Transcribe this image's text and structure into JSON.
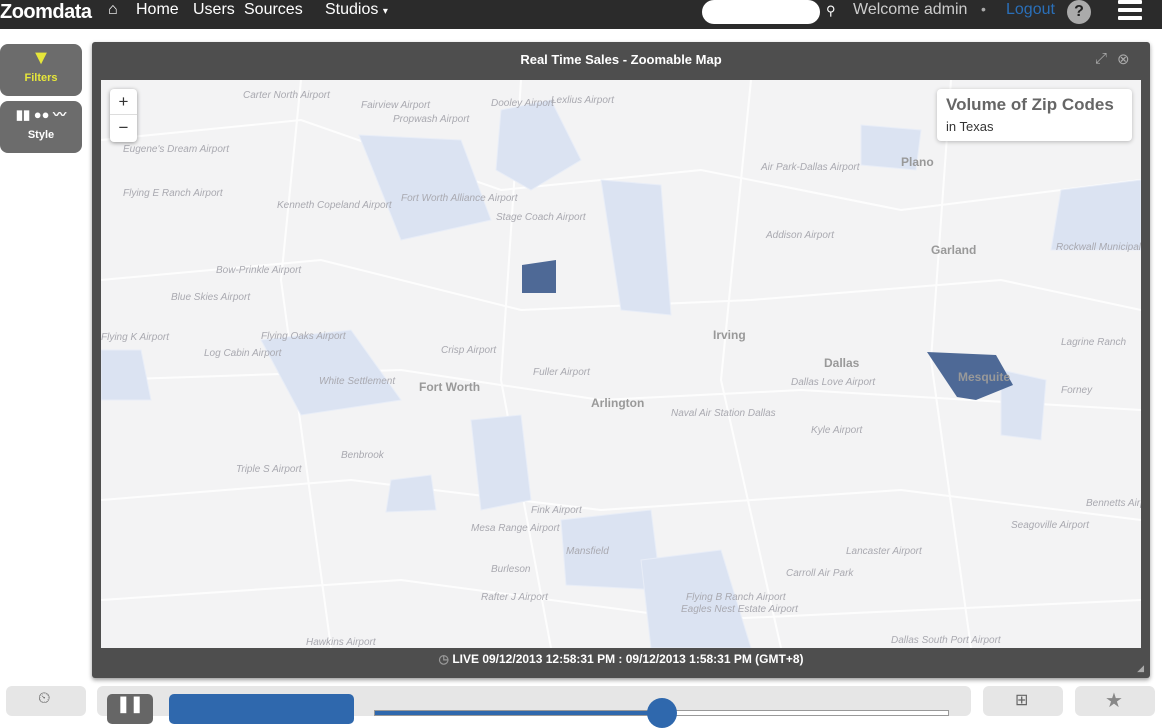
{
  "nav": {
    "brand": "Zoomdata",
    "home_icon": "home-icon",
    "links": [
      "Home",
      "Users",
      "Sources",
      "Studios"
    ],
    "search_placeholder": "",
    "welcome": "Welcome admin",
    "separator": "•",
    "logout": "Logout",
    "help": "?"
  },
  "sidebar": {
    "filters": "Filters",
    "style": "Style"
  },
  "panel": {
    "title": "Real Time Sales - Zoomable Map",
    "footer_live": "LIVE",
    "footer_range": "09/12/2013 12:58:31 PM : 09/12/2013 1:58:31 PM (GMT+8)"
  },
  "map": {
    "zoom_in": "+",
    "zoom_out": "−",
    "legend": {
      "title": "Volume of Zip Codes",
      "subtitle": "in Texas"
    },
    "cities": [
      "Plano",
      "Garland",
      "Irving",
      "Fort Worth",
      "Arlington",
      "Dallas",
      "Mesquite"
    ],
    "labels": [
      "Carter North Airport",
      "Fairview Airport",
      "Dooley Airport",
      "Lexlius Airport",
      "Propwash Airport",
      "Eugene's Dream Airport",
      "Flying E Ranch Airport",
      "Kenneth Copeland Airport",
      "Fort Worth Alliance Airport",
      "Stage Coach Airport",
      "Bow-Prinkle Airport",
      "Blue Skies Airport",
      "Flying K Airport",
      "Log Cabin Airport",
      "Flying Oaks Airport",
      "White Settlement",
      "Fuller Airport",
      "Naval Air Station Dallas",
      "Triple S Airport",
      "Air Park-Dallas Airport",
      "Addison Airport",
      "Rockwall Municipal Airport",
      "Lagrine Ranch",
      "Forney",
      "Lancaster Airport",
      "Carroll Air Park",
      "Flying B Ranch Airport",
      "Eagles Nest Estate Airport",
      "Hawkins Airport",
      "Rafter J Airport",
      "Mesa Range Airport",
      "Fink Airport",
      "Seagoville Airport",
      "Bennetts Airport",
      "Mansfield",
      "Burleson",
      "Dallas South Port Airport",
      "Benbrook",
      "Dallas Love Airport",
      "Kyle Airport",
      "Crisp Airport"
    ],
    "colors": {
      "light": "#dbe3f2",
      "dark": "#3c5a8c",
      "bg": "#f3f3f4"
    }
  },
  "bottom": {
    "pause_icon": "pause-icon",
    "timeline_progress": 0.5
  }
}
